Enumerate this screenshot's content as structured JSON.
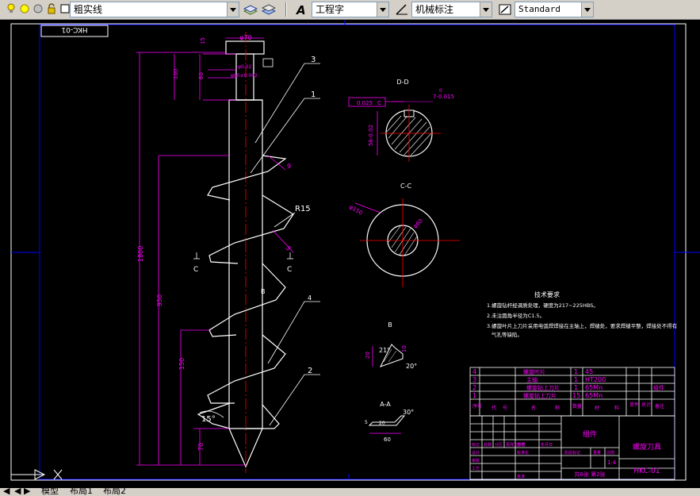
{
  "toolbar": {
    "layer_name": "粗实线",
    "text_style": "工程字",
    "dim_style": "机械标注",
    "table_style": "Standard",
    "icons": [
      "lightbulb-icon",
      "sun-icon",
      "freeze-icon",
      "lock-icon",
      "color-swatch-icon",
      "layer-manager-icon",
      "layer-previous-icon",
      "text-style-icon",
      "dim-style-icon",
      "table-style-icon"
    ]
  },
  "drawing": {
    "frame_code": "HKC-01",
    "dims": {
      "d70": "φ70",
      "d15": "15",
      "d100": "100",
      "d60": "60",
      "tol_flat": "φ0.02",
      "tol_center": "φ60±0.002",
      "len_total": "1800",
      "len_950": "950",
      "len_150": "150",
      "len_70": "70",
      "angle_15": "15°",
      "radius": "R15",
      "dim_5": "5",
      "dim_9": "9"
    },
    "parts": [
      "3",
      "1",
      "4",
      "2"
    ],
    "section_labels": {
      "dd_title": "D-D",
      "dd_tol": "0.025",
      "dd_tol_ref": "C",
      "dd_keyway": "7-0.015",
      "dd_zero": "0",
      "dd_dia": "56-0.02",
      "cc_title": "C-C",
      "cc_outer": "φ150",
      "cc_inner": "φ60",
      "c_mark": "C",
      "b_title": "B",
      "b_angle1": "21°",
      "b_dim20": "20",
      "b_dim10": "10",
      "b_angle2": "20°",
      "b_mark": "B",
      "aa_title": "A-A",
      "aa_angle": "30°",
      "aa_dim5": "5",
      "aa_dim20": "20",
      "aa_dim60": "60"
    },
    "tech_req": {
      "title": "技术要求",
      "lines": [
        "1.螺旋钻杆经调质处理，硬度为217~225HBS。",
        "2.未注圆角半径为C1.5。",
        "3.螺旋叶片上刀片采用电弧焊焊接在主轴上，焊缝处，要求焊缝平整，焊接处不得有",
        "气孔等缺陷。"
      ]
    },
    "bom": {
      "rows": [
        {
          "no": "4",
          "name": "螺旋叶片",
          "qty": "1",
          "mat": "45",
          "note": ""
        },
        {
          "no": "3",
          "name": "主轴",
          "qty": "1",
          "mat": "HT200",
          "note": ""
        },
        {
          "no": "2",
          "name": "螺旋钻上刀片",
          "qty": "1",
          "mat": "65Mn",
          "note": "组件"
        },
        {
          "no": "1",
          "name": "螺旋钻上刀片",
          "qty": "15",
          "mat": "65Mn",
          "note": ""
        }
      ],
      "header": [
        "序号",
        "代",
        "号",
        "名",
        "称",
        "数量",
        "材",
        "料",
        "单件",
        "总计",
        "备注"
      ]
    },
    "title_block": {
      "assembly": "组件",
      "drawing_name": "螺旋刀具",
      "code": "HKC-01",
      "scale": "1:4",
      "sheet": "共6张 第2张",
      "labels": [
        "标记",
        "处数",
        "分区",
        "更改文件号",
        "签名",
        "年月日",
        "设计",
        "标准化",
        "阶段标记",
        "重量",
        "比例",
        "审核",
        "工艺",
        "批准"
      ]
    }
  },
  "tabs": {
    "model": "模型",
    "layout1": "布局1",
    "layout2": "布局2"
  }
}
